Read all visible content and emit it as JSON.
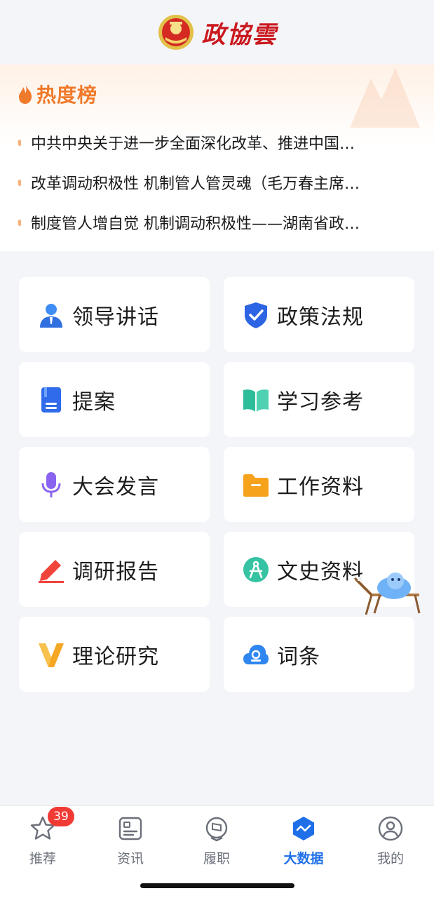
{
  "header": {
    "brand": "政協雲"
  },
  "hot": {
    "title": "热度榜",
    "items": [
      "中共中央关于进一步全面深化改革、推进中国…",
      "改革调动积极性 机制管人管灵魂（毛万春主席…",
      "制度管人增自觉 机制调动积极性——湖南省政…"
    ]
  },
  "menu": [
    {
      "label": "领导讲话",
      "icon": "leader-person-icon"
    },
    {
      "label": "政策法规",
      "icon": "shield-check-icon"
    },
    {
      "label": "提案",
      "icon": "proposal-document-icon"
    },
    {
      "label": "学习参考",
      "icon": "open-book-icon"
    },
    {
      "label": "大会发言",
      "icon": "microphone-icon"
    },
    {
      "label": "工作资料",
      "icon": "folder-icon"
    },
    {
      "label": "调研报告",
      "icon": "pencil-icon"
    },
    {
      "label": "文史资料",
      "icon": "compass-icon"
    },
    {
      "label": "理论研究",
      "icon": "v-logo-icon"
    },
    {
      "label": "词条",
      "icon": "cloud-entry-icon"
    }
  ],
  "tabbar": {
    "badge": "39",
    "tabs": [
      {
        "label": "推荐",
        "active": false
      },
      {
        "label": "资讯",
        "active": false
      },
      {
        "label": "履职",
        "active": false
      },
      {
        "label": "大数据",
        "active": true
      },
      {
        "label": "我的",
        "active": false
      }
    ]
  },
  "colors": {
    "accent": "#1f6fe8",
    "hot": "#f07a2b",
    "brand": "#c9181e",
    "badge": "#f23a35"
  }
}
